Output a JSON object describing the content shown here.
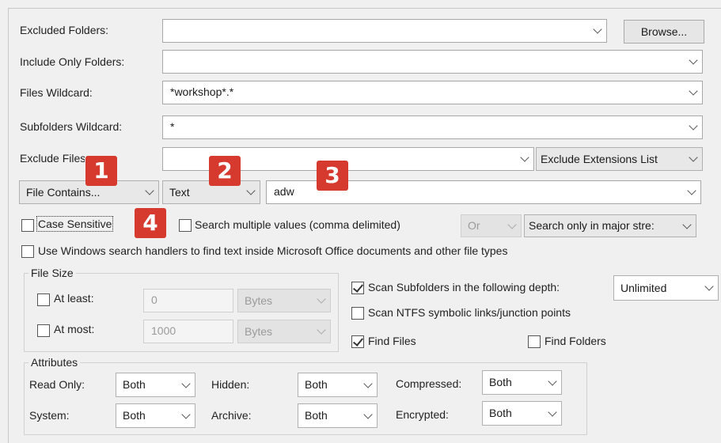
{
  "excluded_folders": {
    "label": "Excluded Folders:",
    "value": "",
    "browse_label": "Browse..."
  },
  "include_only_folders": {
    "label": "Include Only Folders:",
    "value": ""
  },
  "files_wildcard": {
    "label": "Files Wildcard:",
    "value": "*workshop*.*"
  },
  "subfolders_wildcard": {
    "label": "Subfolders Wildcard:",
    "value": "*"
  },
  "exclude_files": {
    "label": "Exclude Files:",
    "value": "",
    "extensions_option": "Exclude Extensions List"
  },
  "search": {
    "mode": "File Contains...",
    "type": "Text",
    "value": "adw"
  },
  "badges": [
    "1",
    "2",
    "3",
    "4"
  ],
  "options": {
    "case_sensitive": {
      "label": "Case Sensitive",
      "checked": false
    },
    "multiple_values": {
      "label": "Search multiple values (comma delimited)",
      "checked": false
    },
    "or_option": "Or",
    "stream_option": "Search only in major stre:",
    "windows_handlers": {
      "label": "Use Windows search handlers to find text inside Microsoft Office documents and other file types",
      "checked": false
    }
  },
  "file_size": {
    "title": "File Size",
    "at_least": {
      "label": "At least:",
      "value": "0",
      "unit": "Bytes",
      "checked": false
    },
    "at_most": {
      "label": "At most:",
      "value": "1000",
      "unit": "Bytes",
      "checked": false
    }
  },
  "scan": {
    "subfolders": {
      "label": "Scan Subfolders in the following depth:",
      "checked": true,
      "depth": "Unlimited"
    },
    "ntfs": {
      "label": "Scan NTFS symbolic links/junction points",
      "checked": false
    },
    "find_files": {
      "label": "Find Files",
      "checked": true
    },
    "find_folders": {
      "label": "Find Folders",
      "checked": false
    }
  },
  "attributes": {
    "title": "Attributes",
    "read_only": {
      "label": "Read Only:",
      "value": "Both"
    },
    "hidden": {
      "label": "Hidden:",
      "value": "Both"
    },
    "compressed": {
      "label": "Compressed:",
      "value": "Both"
    },
    "system": {
      "label": "System:",
      "value": "Both"
    },
    "archive": {
      "label": "Archive:",
      "value": "Both"
    },
    "encrypted": {
      "label": "Encrypted:",
      "value": "Both"
    }
  }
}
